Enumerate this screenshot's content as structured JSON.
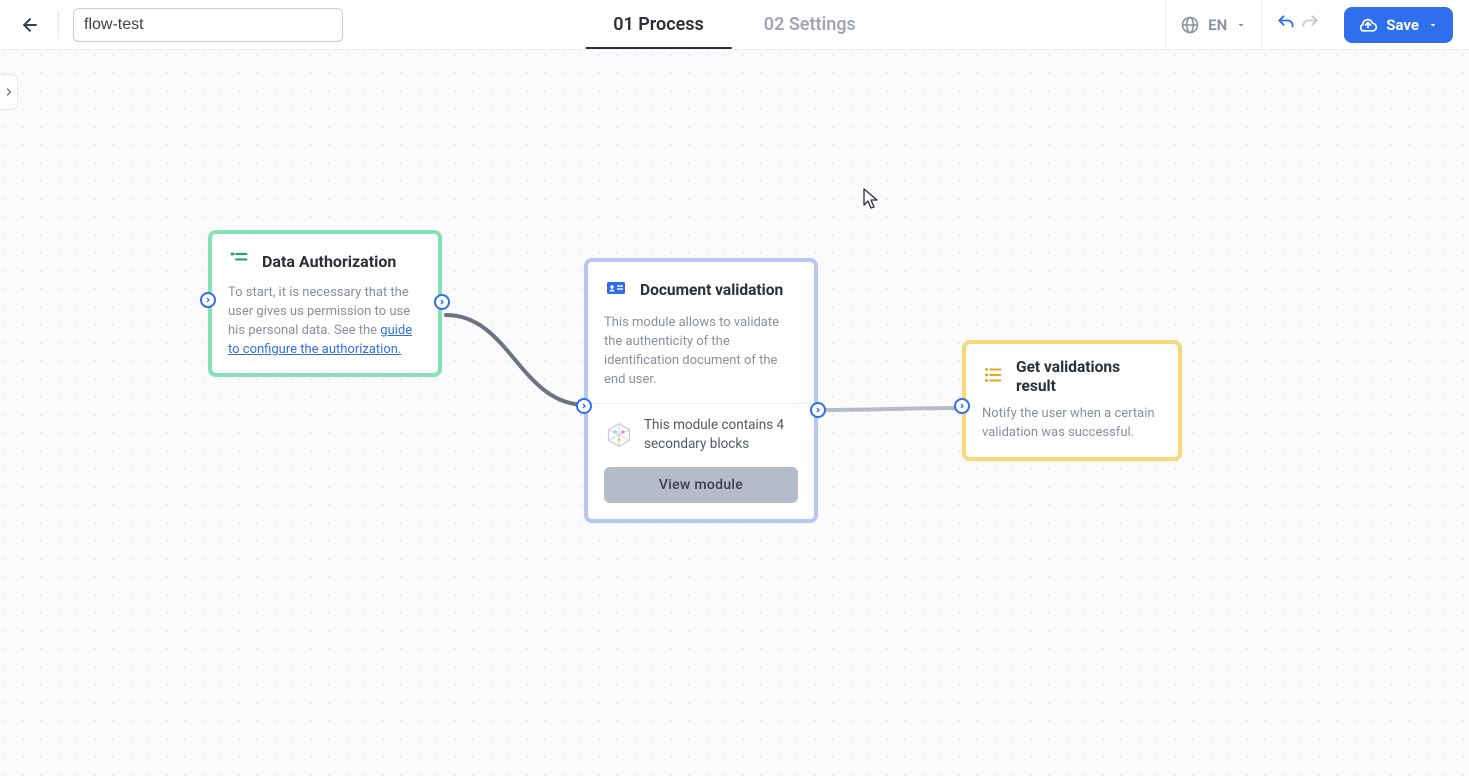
{
  "header": {
    "flow_name": "flow-test",
    "tabs": [
      {
        "label": "01 Process",
        "active": true
      },
      {
        "label": "02 Settings",
        "active": false
      }
    ],
    "language_label": "EN",
    "save_label": "Save"
  },
  "nodes": {
    "data_auth": {
      "title": "Data Authorization",
      "desc_pre": "To start, it is necessary that the user gives us permission to use his personal data. See the ",
      "desc_link": "guide to configure the authorization.",
      "accent": "#86e0b5",
      "icon": "list-check-icon"
    },
    "doc_validation": {
      "title": "Document validation",
      "desc": "This module allows to validate the authenticity of the identification document of the end user.",
      "sub_text": "This module contains 4 secondary blocks",
      "button_label": "View module",
      "accent": "#b6c8ef",
      "icon": "id-card-icon"
    },
    "validations_result": {
      "title": "Get validations result",
      "desc": "Notify the user when a certain validation was successful.",
      "accent": "#f6d97a",
      "icon": "list-ordered-icon"
    }
  },
  "edges": [
    {
      "from": "data_auth",
      "to": "doc_validation"
    },
    {
      "from": "doc_validation",
      "to": "validations_result"
    }
  ]
}
